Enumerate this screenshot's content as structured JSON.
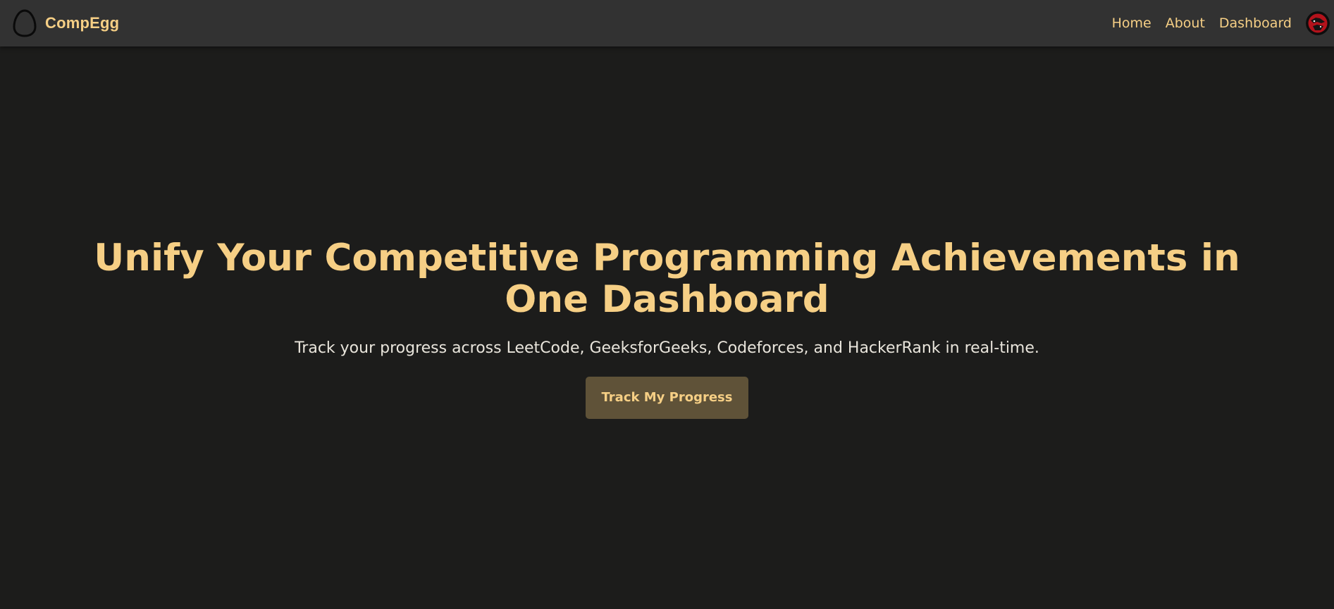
{
  "navbar": {
    "brand": {
      "icon": "egg-icon",
      "name": "CompEgg"
    },
    "links": [
      {
        "label": "Home"
      },
      {
        "label": "About"
      },
      {
        "label": "Dashboard"
      }
    ],
    "avatar": {
      "icon": "user-avatar",
      "color": "#b3121b"
    }
  },
  "hero": {
    "title": "Unify Your Competitive Programming Achievements in One Dashboard",
    "subtitle": "Track your progress across LeetCode, GeeksforGeeks, Codeforces, and HackerRank in real-time.",
    "cta_label": "Track My Progress"
  },
  "colors": {
    "accent": "#f6cf85",
    "background": "#1c1c1b",
    "navbar": "#323232",
    "button": "#5f5238"
  }
}
